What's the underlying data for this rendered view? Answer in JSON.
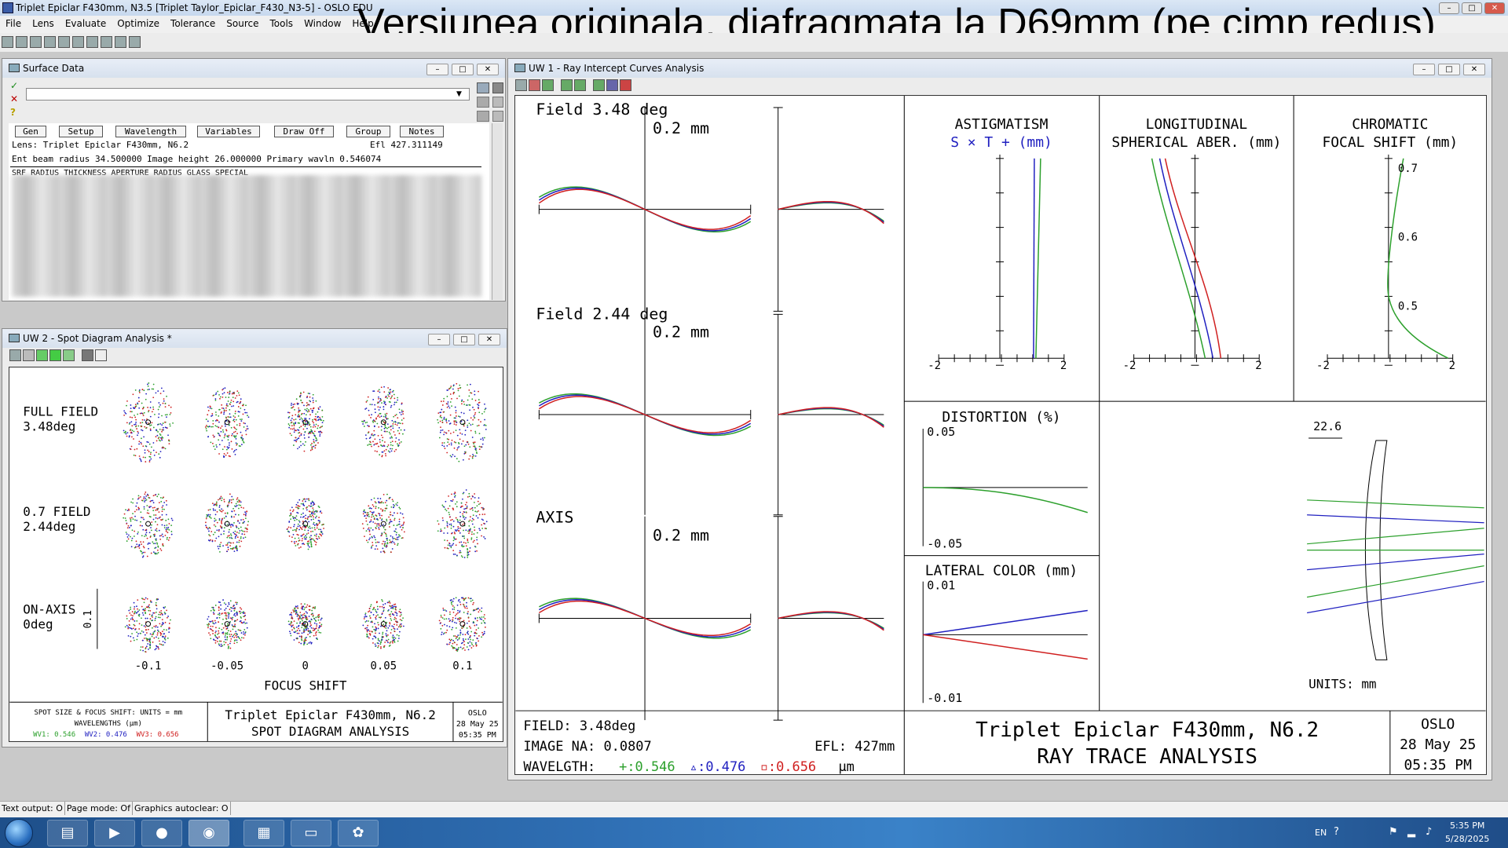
{
  "app": {
    "window_title": "Triplet Epiclar F430mm, N3.5 [Triplet Taylor_Epiclar_F430_N3-5] - OSLO EDU",
    "overlay_title": "Versiunea originala, diafragmata la D69mm (pe cimp redus)"
  },
  "menu": [
    "File",
    "Lens",
    "Evaluate",
    "Optimize",
    "Tolerance",
    "Source",
    "Tools",
    "Window",
    "Help"
  ],
  "window_buttons": {
    "min": "–",
    "max": "□",
    "close": "✕"
  },
  "surface_data": {
    "title": "Surface Data",
    "buttons": [
      "Gen",
      "Setup",
      "Wavelength",
      "Variables",
      "Draw Off",
      "Group",
      "Notes"
    ],
    "line1_left": "Lens: Triplet Epiclar F430mm, N6.2",
    "line1_right": "Efl   427.311149",
    "line2": "Ent beam radius   34.500000 Image height     26.000000 Primary wavln    0.546074",
    "header": "SRF      RADIUS        THICKNESS     APERTURE RADIUS      GLASS       SPECIAL"
  },
  "spot": {
    "title": "UW 2 - Spot Diagram Analysis *",
    "rows": [
      {
        "name": "FULL FIELD",
        "val": "3.48deg"
      },
      {
        "name": "0.7 FIELD",
        "val": "2.44deg"
      },
      {
        "name": "ON-AXIS",
        "val": "0deg"
      }
    ],
    "scale_label": "0.1",
    "x_ticks": [
      "-0.1",
      "-0.05",
      "0",
      "0.05",
      "0.1"
    ],
    "x_label": "FOCUS SHIFT",
    "footer_left_1": "SPOT SIZE & FOCUS SHIFT: UNITS = mm",
    "footer_left_2": "WAVELENGTHS (μm)",
    "wv": [
      "WV1: 0.546",
      "WV2: 0.476",
      "WV3: 0.656"
    ],
    "footer_mid_1": "Triplet Epiclar F430mm, N6.2",
    "footer_mid_2": "SPOT DIAGRAM ANALYSIS",
    "footer_right": [
      "OSLO",
      "28 May 25",
      "05:35 PM"
    ]
  },
  "ray": {
    "title": "UW 1 - Ray Intercept Curves Analysis",
    "fields": [
      "Field 3.48 deg",
      "Field 2.44 deg",
      "AXIS"
    ],
    "scale": "0.2 mm",
    "astig_title": "ASTIGMATISM",
    "astig_sub": "S × T + (mm)",
    "long_title1": "LONGITUDINAL",
    "long_title2": "SPHERICAL ABER. (mm)",
    "chrom_title1": "CHROMATIC",
    "chrom_title2": "FOCAL SHIFT (mm)",
    "chrom_ticks": [
      "0.7",
      "0.6",
      "0.5"
    ],
    "m2": "-2",
    "p2": "2",
    "dist_title": "DISTORTION (%)",
    "dist_top": "0.05",
    "dist_bot": "-0.05",
    "lat_title": "LATERAL COLOR (mm)",
    "lat_top": "0.01",
    "lat_bot": "-0.01",
    "lens_scale": "22.6",
    "units": "UNITS: mm",
    "foot_field": "FIELD: 3.48deg",
    "foot_na": "IMAGE NA: 0.0807",
    "foot_efl": "EFL: 427mm",
    "foot_wl_label": "WAVELGTH:",
    "foot_wl": [
      "+:0.546",
      "▵:0.476",
      "▫:0.656"
    ],
    "foot_wl_unit": "μm",
    "foot_title1": "Triplet Epiclar F430mm, N6.2",
    "foot_title2": "RAY TRACE ANALYSIS",
    "foot_right": [
      "OSLO",
      "28 May 25",
      "05:35 PM"
    ]
  },
  "status": [
    "Text output: O",
    "Page mode: Of",
    "Graphics autoclear: O"
  ],
  "tray": {
    "lang": "EN",
    "time": "5:35 PM",
    "date": "5/28/2025"
  },
  "colors": {
    "green": "#2ca02c",
    "blue": "#2020c0",
    "red": "#d02020"
  }
}
